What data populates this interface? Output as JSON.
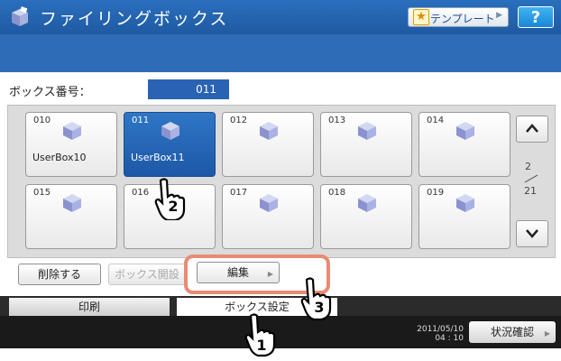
{
  "header": {
    "title": "ファイリングボックス",
    "template_label": "テンプレート",
    "help_label": "?"
  },
  "box_number": {
    "label": "ボックス番号：",
    "value": "011"
  },
  "boxes": [
    {
      "num": "010",
      "name": "UserBox10",
      "selected": false
    },
    {
      "num": "011",
      "name": "UserBox11",
      "selected": true
    },
    {
      "num": "012",
      "name": "",
      "selected": false
    },
    {
      "num": "013",
      "name": "",
      "selected": false
    },
    {
      "num": "014",
      "name": "",
      "selected": false
    },
    {
      "num": "015",
      "name": "",
      "selected": false
    },
    {
      "num": "016",
      "name": "",
      "selected": false
    },
    {
      "num": "017",
      "name": "",
      "selected": false
    },
    {
      "num": "018",
      "name": "",
      "selected": false
    },
    {
      "num": "019",
      "name": "",
      "selected": false
    }
  ],
  "pager": {
    "current": "2",
    "total": "21"
  },
  "actions": {
    "delete": "削除する",
    "open": "ボックス開設",
    "edit": "編集"
  },
  "tabs": {
    "print": "印刷",
    "box_settings": "ボックス設定"
  },
  "footer": {
    "date": "2011/05/10",
    "time": "04 : 10",
    "status": "状況確認"
  },
  "callouts": [
    "1",
    "2",
    "3"
  ],
  "colors": {
    "header_blue": "#2a6fbd",
    "selected_blue": "#1d58a6",
    "highlight": "#e98b74",
    "tab_underline": "#f0a500"
  }
}
